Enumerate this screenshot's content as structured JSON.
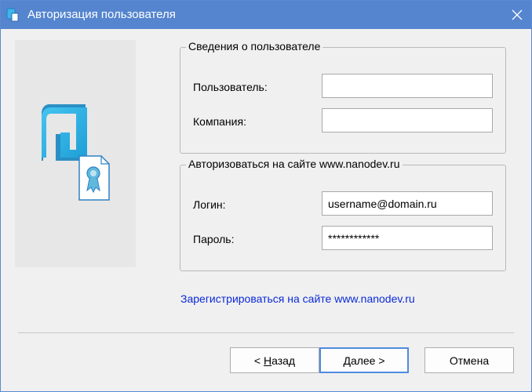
{
  "window": {
    "title": "Авторизация пользователя"
  },
  "user_group": {
    "title": "Сведения о пользователе",
    "user_label": "Пользователь:",
    "user_value": "",
    "company_label": "Компания:",
    "company_value": ""
  },
  "site_group": {
    "title": "Авторизоваться на сайте www.nanodev.ru",
    "login_label": "Логин:",
    "login_value": "username@domain.ru",
    "password_label": "Пароль:",
    "password_value": "************"
  },
  "register_link": "Зарегистрироваться на сайте www.nanodev.ru",
  "buttons": {
    "back_prefix": "< ",
    "back_mnemonic": "Н",
    "back_rest": "азад",
    "next_prefix": "",
    "next_mnemonic": "Д",
    "next_rest": "алее >",
    "cancel": "Отмена"
  },
  "colors": {
    "titlebar": "#5585cf",
    "link": "#0b2ad9",
    "logo_cyan": "#35b5e8",
    "badge": "#5fb9dd"
  }
}
